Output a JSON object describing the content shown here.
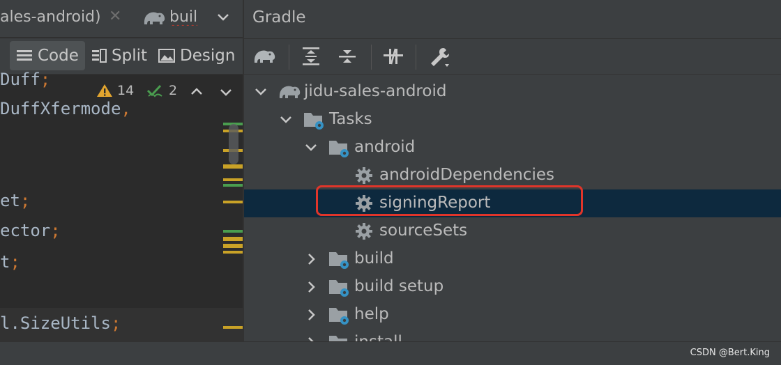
{
  "editor": {
    "tab_label": "ales-android)",
    "tab2_label": "buil",
    "view_modes": {
      "code": "Code",
      "split": "Split",
      "design": "Design"
    },
    "warnings_count": "14",
    "checks_count": "2",
    "code_lines": [
      {
        "text": "Duff",
        "semi": ";"
      },
      {
        "text": "DuffXfermode",
        "semi": ","
      },
      {
        "text": "et",
        "semi": ";"
      },
      {
        "text": "ector",
        "semi": ";"
      },
      {
        "text": "t",
        "semi": ";"
      },
      {
        "text": "l.SizeUtils",
        "semi": ";"
      }
    ]
  },
  "gradle": {
    "title": "Gradle",
    "tree": {
      "project": "jidu-sales-android",
      "tasks": "Tasks",
      "android": "android",
      "android_tasks": [
        "androidDependencies",
        "signingReport",
        "sourceSets"
      ],
      "groups": [
        "build",
        "build setup",
        "help",
        "install"
      ]
    },
    "selected_item": "signingReport"
  },
  "colors": {
    "highlight_border": "#e0352a",
    "selection_bg": "#0d293e",
    "gear_blue": "#3592c4",
    "warning_yellow": "#e2a52f",
    "check_green": "#4a9d4f"
  },
  "watermark": "CSDN @Bert.King"
}
